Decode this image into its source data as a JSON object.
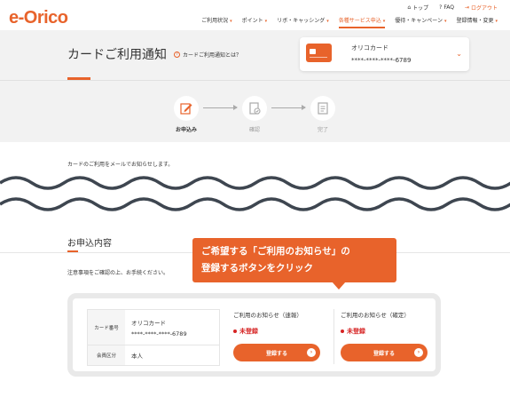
{
  "header": {
    "logo": "e-Orico",
    "util_links": [
      "トップ",
      "FAQ",
      "ログアウト"
    ],
    "nav": [
      "ご利用状況",
      "ポイント",
      "リボ・キャッシング",
      "各種サービス申込",
      "優待・キャンペーン",
      "登録情報・変更"
    ],
    "active_nav_index": 3
  },
  "title_band": {
    "title": "カードご利用通知",
    "help_link": "カードご利用通知とは？",
    "card": {
      "name": "オリコカード",
      "number": "****-****-****-6789"
    }
  },
  "steps": [
    {
      "label": "お申込み",
      "active": true
    },
    {
      "label": "確認",
      "active": false
    },
    {
      "label": "完了",
      "active": false
    }
  ],
  "intro_text": "カードのご利用をメールでお知らせします。",
  "section": {
    "title": "お申込内容",
    "note": "注意事項をご確認の上、お手続ください。"
  },
  "callout": {
    "line1": "ご希望する「ご利用のお知らせ」の",
    "line2": "登録するボタンをクリック"
  },
  "info": {
    "card_key": "カード番号",
    "card_name": "オリコカード",
    "card_number": "****-****-****-6789",
    "member_key": "会員区分",
    "member_value": "本人"
  },
  "options": [
    {
      "title": "ご利用のお知らせ（速報）",
      "status": "未登録",
      "button": "登録する"
    },
    {
      "title": "ご利用のお知らせ（確定）",
      "status": "未登録",
      "button": "登録する"
    }
  ],
  "colors": {
    "accent": "#e8632b",
    "status": "#d62323",
    "band": "#f2f2f2",
    "wave": "#3e4650"
  }
}
